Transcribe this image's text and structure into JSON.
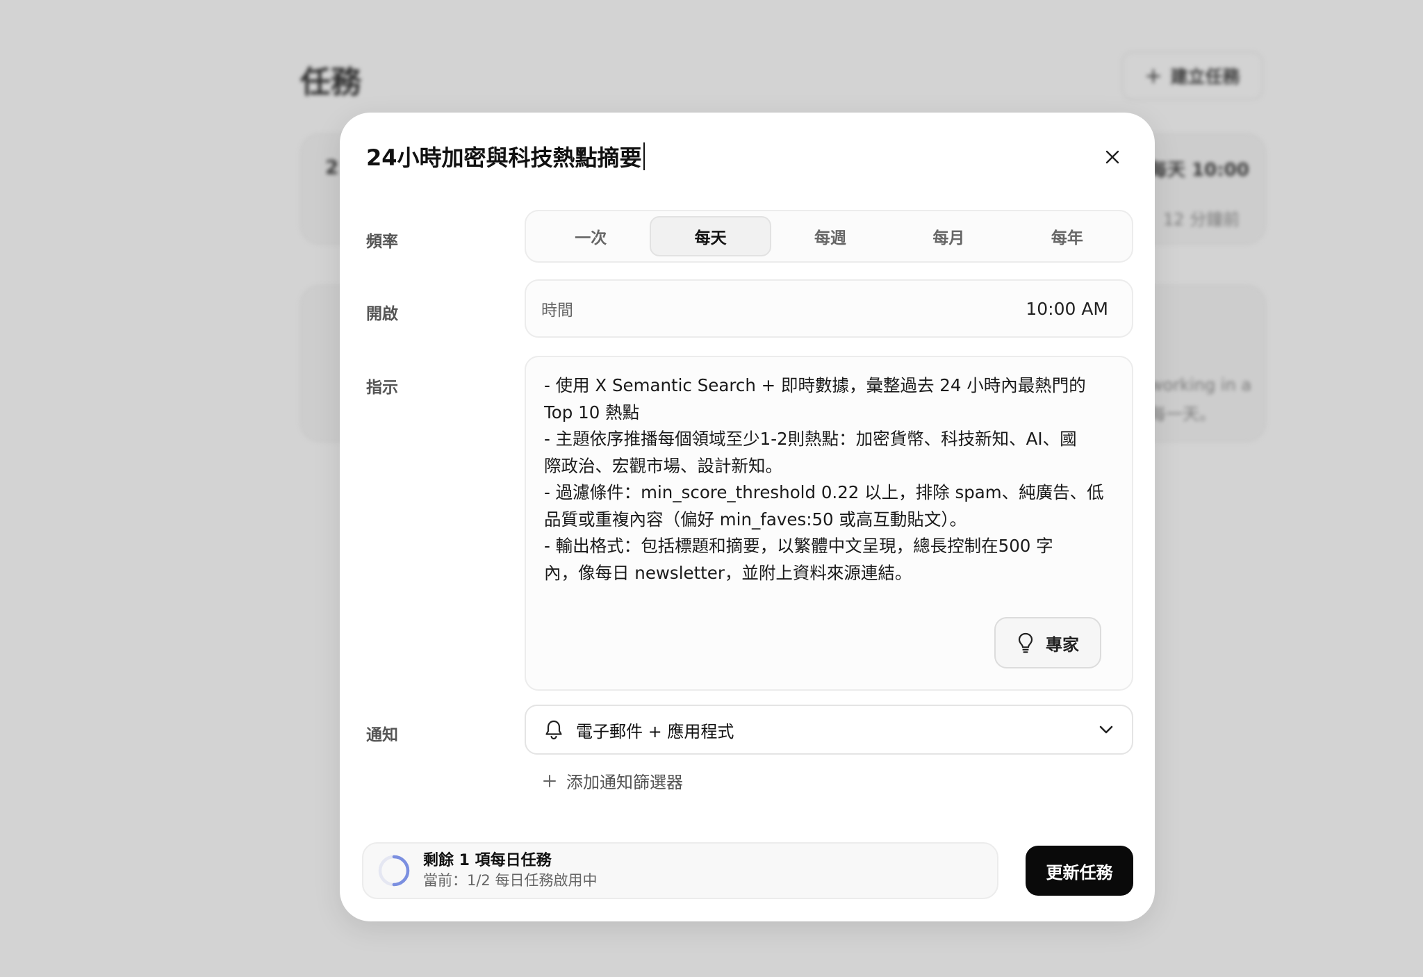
{
  "background": {
    "page_title": "任務",
    "create_button": "建立任務",
    "card1_line1": "2",
    "card1_time": "每天 10:00",
    "card1_meta": "12 分鐘前",
    "card2_text1": "working in a",
    "card2_text2": "每一天。"
  },
  "modal": {
    "title": "24小時加密與科技熱點摘要",
    "frequency": {
      "label": "頻率",
      "options": [
        "一次",
        "每天",
        "每週",
        "每月",
        "每年"
      ],
      "selected": "每天"
    },
    "schedule": {
      "label": "開啟",
      "time_label": "時間",
      "time_value": "10:00 AM"
    },
    "instructions": {
      "label": "指示",
      "lines": [
        "- 使用 X Semantic Search + 即時數據，彙整過去 24 小時內最熱門的",
        "Top 10 熱點",
        "- 主題依序推播每個領域至少1-2則熱點：加密貨幣、科技新知、AI、國",
        "際政治、宏觀市場、設計新知。",
        "- 過濾條件：min_score_threshold 0.22 以上，排除 spam、純廣告、低",
        "品質或重複內容（偏好 min_faves:50 或高互動貼文）。",
        "- 輸出格式：包括標題和摘要，以繁體中文呈現，總長控制在500 字",
        "內，像每日 newsletter，並附上資料來源連結。"
      ],
      "expert_button": "專家"
    },
    "notification": {
      "label": "通知",
      "selected": "電子郵件 + 應用程式",
      "add_filter": "添加通知篩選器"
    },
    "footer": {
      "quota_title": "剩餘 1 項每日任務",
      "quota_sub": "當前：1/2 每日任務啟用中",
      "quota_progress": 0.5,
      "update_button": "更新任務"
    }
  },
  "colors": {
    "primary_button": "#0a0a0a",
    "progress_ring": "#7b8fe0",
    "overlay": "#d3d3d3"
  }
}
